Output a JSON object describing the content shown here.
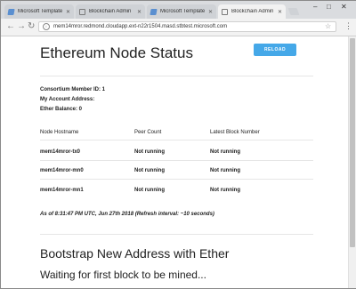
{
  "browser": {
    "tabs": [
      {
        "label": "Microsoft Template - M",
        "icon": "microsoft-template-favicon"
      },
      {
        "label": "Blockchain Admin",
        "icon": "page-favicon"
      },
      {
        "label": "Microsoft Template - M",
        "icon": "microsoft-template-favicon"
      },
      {
        "label": "Blockchain Admin",
        "icon": "page-favicon"
      }
    ],
    "active_tab_index": 3,
    "address": "mem14mror.redmond.cloudapp.ext-n22r1504.masd.stbtest.microsoft.com"
  },
  "page": {
    "title": "Ethereum Node Status",
    "reload_label": "RELOAD",
    "consortium_member": "Consortium Member ID: 1",
    "account_address": "My Account Address:",
    "ether_balance": "Ether Balance: 0",
    "table": {
      "headers": [
        "Node Hostname",
        "Peer Count",
        "Latest Block Number"
      ],
      "rows": [
        [
          "mem14mror-tx0",
          "Not running",
          "Not running"
        ],
        [
          "mem14mror-mn0",
          "Not running",
          "Not running"
        ],
        [
          "mem14mror-mn1",
          "Not running",
          "Not running"
        ]
      ]
    },
    "as_of": "As of 8:31:47 PM UTC, Jun 27th 2018 (Refresh interval: ~10 seconds)",
    "bootstrap_heading": "Bootstrap New Address with Ether",
    "waiting_text": "Waiting for first block to be mined..."
  },
  "colors": {
    "accent": "#45a8e8",
    "tabbar": "#dadcdf",
    "toolbar": "#f2f2f2"
  }
}
